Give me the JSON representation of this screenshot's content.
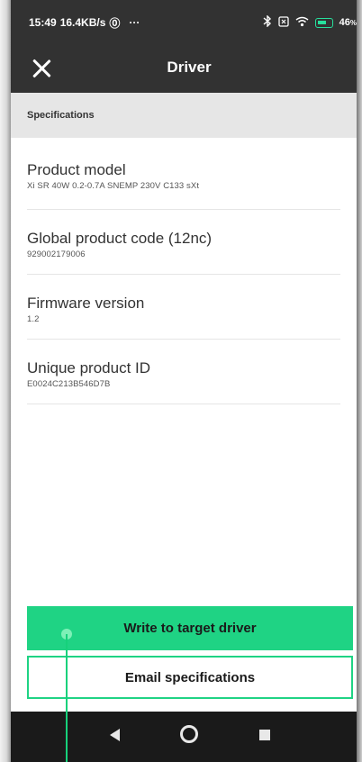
{
  "status_bar": {
    "time": "15:49",
    "speed": "16.4KB/s",
    "app_glyph": "⓪",
    "more": "···",
    "battery_level": "46",
    "battery_suffix": "%",
    "icons": [
      "bluetooth-icon",
      "sim-icon",
      "wifi-icon",
      "battery-charging-icon"
    ]
  },
  "app_bar": {
    "title": "Driver",
    "close_icon": "close-icon"
  },
  "section": {
    "title": "Specifications"
  },
  "specs": [
    {
      "label": "Product model",
      "value": "Xi SR 40W 0.2-0.7A SNEMP 230V C133 sXt"
    },
    {
      "label": "Global product code (12nc)",
      "value": "929002179006"
    },
    {
      "label": "Firmware version",
      "value": "1.2"
    },
    {
      "label": "Unique product ID",
      "value": "E0024C213B546D7B"
    }
  ],
  "actions": {
    "write_label": "Write to target driver",
    "email_label": "Email specifications"
  },
  "nav_bar": {
    "icons": [
      "back-icon",
      "home-icon",
      "recent-apps-icon"
    ]
  },
  "colors": {
    "accent": "#1fd384",
    "app_bar": "#323232",
    "section_bg": "#e6e6e6",
    "nav_bar": "#1a1a1a"
  }
}
